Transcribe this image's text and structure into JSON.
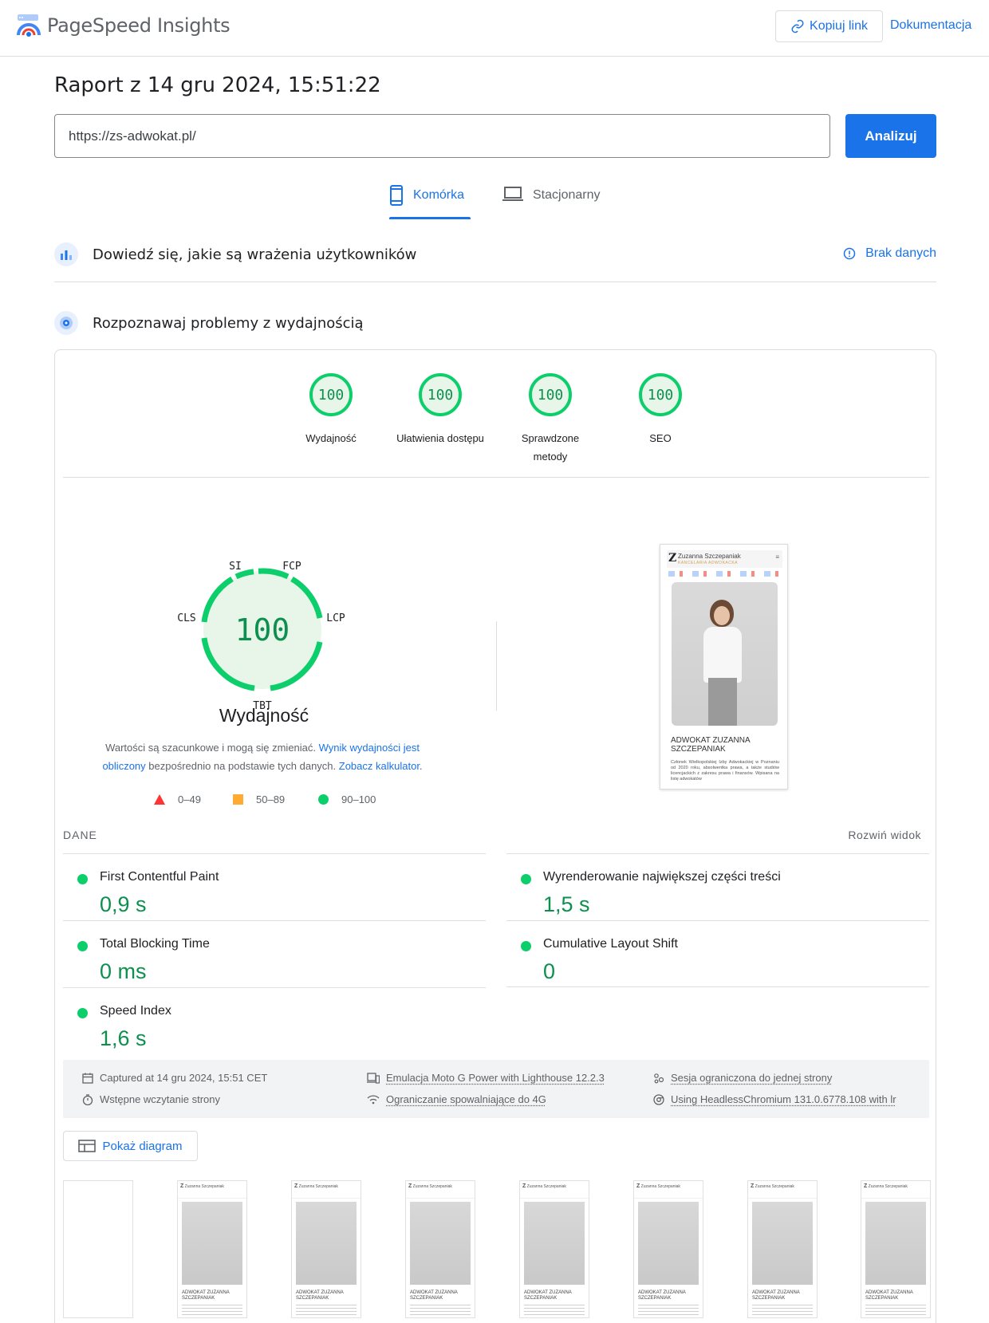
{
  "header": {
    "brand": "PageSpeed Insights",
    "copy_link": "Kopiuj link",
    "docs": "Dokumentacja"
  },
  "report_title": "Raport z 14 gru 2024, 15:51:22",
  "url_input": {
    "value": "https://zs-adwokat.pl/"
  },
  "analyze_label": "Analizuj",
  "tabs": [
    {
      "label": "Komórka",
      "active": true
    },
    {
      "label": "Stacjonarny",
      "active": false
    }
  ],
  "ux_section": {
    "title": "Dowiedź się, jakie są wrażenia użytkowników",
    "status": "Brak danych"
  },
  "perf_section": {
    "title": "Rozpoznawaj problemy z wydajnością"
  },
  "scores": [
    {
      "value": "100",
      "label": "Wydajność"
    },
    {
      "value": "100",
      "label": "Ułatwienia dostępu"
    },
    {
      "value": "100",
      "label": "Sprawdzone metody"
    },
    {
      "value": "100",
      "label": "SEO"
    }
  ],
  "performance": {
    "score": "100",
    "title": "Wydajność",
    "gauge_labels": {
      "si": "SI",
      "fcp": "FCP",
      "lcp": "LCP",
      "tbt": "TBT",
      "cls": "CLS"
    },
    "disclaimer_prefix": "Wartości są szacunkowe i mogą się zmieniać. ",
    "disclaimer_link1": "Wynik wydajności jest obliczony",
    "disclaimer_middle": " bezpośrednio na podstawie tych danych. ",
    "disclaimer_link2": "Zobacz kalkulator."
  },
  "legend": [
    {
      "range": "0–49",
      "color": "#ff3333",
      "shape": "triangle"
    },
    {
      "range": "50–89",
      "color": "#ffaa33",
      "shape": "square"
    },
    {
      "range": "90–100",
      "color": "#0cce6b",
      "shape": "circle"
    }
  ],
  "screenshot": {
    "site_name": "Zuzanna Szczepaniak",
    "site_sub": "KANCELARIA ADWOKACKA",
    "heading_1": "ADWOKAT ZUZANNA",
    "heading_2": "SZCZEPANIAK",
    "body": "Członek Wielkopolskiej Izby Adwokackiej w Poznaniu od 2020 roku, absolwentka prawa, a także studiów licencjackich z zakresu prawa i finansów. Wpisana na listę adwokatów"
  },
  "metrics_header": {
    "label": "DANE",
    "expand": "Rozwiń widok"
  },
  "metrics": [
    {
      "name": "First Contentful Paint",
      "value": "0,9 s"
    },
    {
      "name": "Wyrenderowanie największej części treści",
      "value": "1,5 s"
    },
    {
      "name": "Total Blocking Time",
      "value": "0 ms"
    },
    {
      "name": "Cumulative Layout Shift",
      "value": "0"
    },
    {
      "name": "Speed Index",
      "value": "1,6 s"
    }
  ],
  "info": {
    "captured": "Captured at 14 gru 2024, 15:51 CET",
    "initial_load": "Wstępne wczytanie strony",
    "emulation": "Emulacja Moto G Power with Lighthouse 12.2.3",
    "throttling": "Ograniczanie spowalniające do 4G",
    "session": "Sesja ograniczona do jednej strony",
    "browser": "Using HeadlessChromium 131.0.6778.108 with lr"
  },
  "diagram_button": "Pokaż diagram",
  "colors": {
    "accent": "#1a73e8",
    "pass": "#0cce6b",
    "pass_text": "#0d904f",
    "pass_bg": "#e8f5e9"
  }
}
